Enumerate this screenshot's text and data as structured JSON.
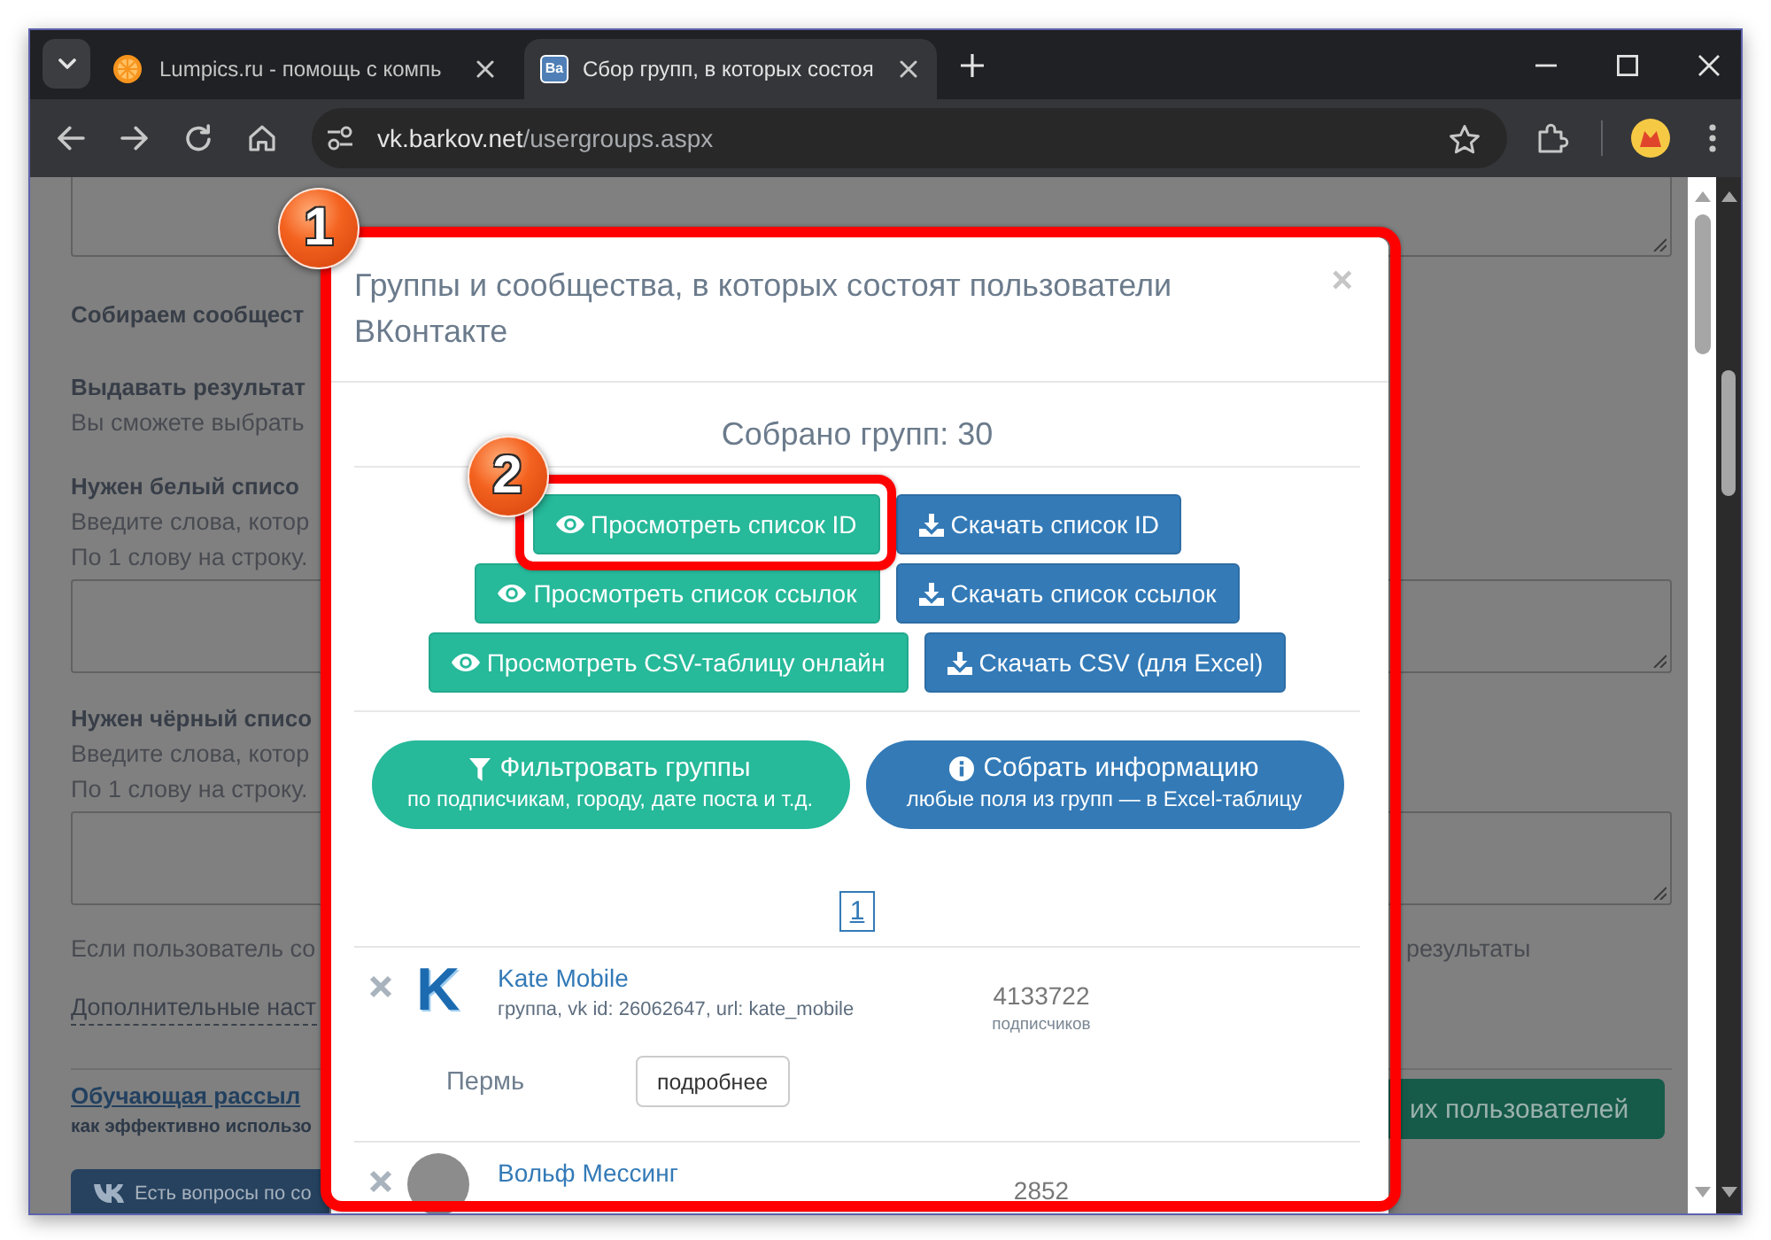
{
  "browser": {
    "tabs": [
      {
        "title": "Lumpics.ru - помощь с компь",
        "selected": false,
        "favicon": {
          "kind": "fruit"
        }
      },
      {
        "title": "Сбор групп, в которых состоя",
        "selected": true,
        "favicon": {
          "kind": "letters",
          "text": "Ва"
        }
      }
    ],
    "address": {
      "host": "vk.barkov.net",
      "path": "/usergroups.aspx"
    }
  },
  "page": {
    "items": [
      {
        "kind": "textarea"
      },
      {
        "kind": "heading",
        "text": "Собираем сообщест"
      },
      {
        "kind": "option",
        "title": "Выдавать результат",
        "lines": [
          "Вы сможете выбрать"
        ]
      },
      {
        "kind": "option",
        "title": "Нужен белый списо",
        "lines": [
          "Введите слова, котор",
          "По 1 слову на строку."
        ]
      },
      {
        "kind": "textarea"
      },
      {
        "kind": "option",
        "title": "Нужен чёрный списо",
        "lines": [
          "Введите слова, котор",
          "По 1 слову на строку."
        ]
      },
      {
        "kind": "textarea"
      },
      {
        "kind": "note",
        "text": "Если пользователь со",
        "right_text": "результаты"
      },
      {
        "kind": "toggle_link",
        "text": "Дополнительные наст"
      },
      {
        "kind": "rule"
      },
      {
        "kind": "promo",
        "link": "Обучающая рассыл",
        "caption": "как эффективно использо",
        "button": "их пользователей"
      },
      {
        "kind": "vk_button",
        "text": "Есть вопросы по со"
      }
    ]
  },
  "modal": {
    "annotation": "1",
    "title": "Группы и сообщества, в которых состоят пользователи ВКонтакте",
    "close": "×",
    "summary": "Собрано групп: 30",
    "action_rows": [
      [
        {
          "kind": "view",
          "label": "Просмотреть список ID",
          "annotation": "2"
        },
        {
          "kind": "download",
          "label": "Скачать список ID"
        }
      ],
      [
        {
          "kind": "view",
          "label": "Просмотреть список ссылок"
        },
        {
          "kind": "download",
          "label": "Скачать список ссылок"
        }
      ],
      [
        {
          "kind": "view",
          "label": "Просмотреть CSV-таблицу онлайн"
        },
        {
          "kind": "download",
          "label": "Скачать CSV (для Excel)"
        }
      ]
    ],
    "pills": [
      {
        "kind": "filter",
        "title": "Фильтровать группы",
        "subtitle": "по подписчикам, городу, дате поста и т.д."
      },
      {
        "kind": "info",
        "title": "Собрать информацию",
        "subtitle": "любые поля из групп — в Excel-таблицу"
      }
    ],
    "pages": [
      {
        "label": "1",
        "selected": true
      }
    ],
    "groups": [
      {
        "name": "Kate Mobile",
        "logo": {
          "kind": "letter",
          "text": "K"
        },
        "details": "группа, vk id: 26062647, url: kate_mobile",
        "subscribers": "4133722",
        "subscribers_label": "подписчиков",
        "city": "Пермь",
        "more": "подробнее"
      },
      {
        "name": "Вольф Мессинг",
        "logo": {
          "kind": "photo"
        },
        "subscribers": "2852"
      }
    ]
  }
}
